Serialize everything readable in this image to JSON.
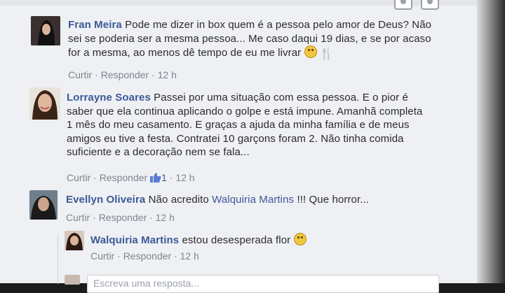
{
  "comments": [
    {
      "author": "Fran Meira",
      "lines": [
        "Pode me dizer in box quem é a pessoa pelo amor de Deus? Não",
        "sei se poderia ser a mesma pessoa... Me caso daqui 19 dias, e se por acaso",
        "for a mesma, ao menos dê tempo de eu me livrar"
      ],
      "emojis": [
        "crying-face-icon",
        "fork-knife-icon"
      ],
      "actions": {
        "like": "Curtir",
        "reply": "Responder",
        "time": "12 h",
        "sep": "·"
      }
    },
    {
      "author": "Lorrayne Soares",
      "lines": [
        "Passei por uma situação com essa pessoa. E o pior é",
        "saber que ela continua aplicando o golpe e está impune. Amanhã completa",
        "1 mês do meu casamento. E graças a ajuda da minha família e de meus",
        "amigos eu tive a festa. Contratei 10 garçons foram 2. Não tinha comida",
        "suficiente e a decoração nem se fala..."
      ],
      "actions": {
        "like": "Curtir",
        "reply": "Responder",
        "likes": "1",
        "time": "12 h",
        "sep": "·"
      }
    },
    {
      "author": "Evellyn Oliveira",
      "text_before": "Não acredito",
      "mention": "Walquiria Martins",
      "text_after": "!!! Que horror...",
      "actions": {
        "like": "Curtir",
        "reply": "Responder",
        "time": "12 h",
        "sep": "·"
      }
    },
    {
      "author": "Walquiria Martins",
      "text": "estou desesperada flor",
      "emoji": "sad-face-icon",
      "actions": {
        "like": "Curtir",
        "reply": "Responder",
        "time": "12 h",
        "sep": "·"
      }
    }
  ],
  "reply_box": {
    "placeholder": "Escreva uma resposta..."
  },
  "colors": {
    "name": "#3b5998",
    "muted": "#7d8591",
    "background": "#eef0f3"
  }
}
